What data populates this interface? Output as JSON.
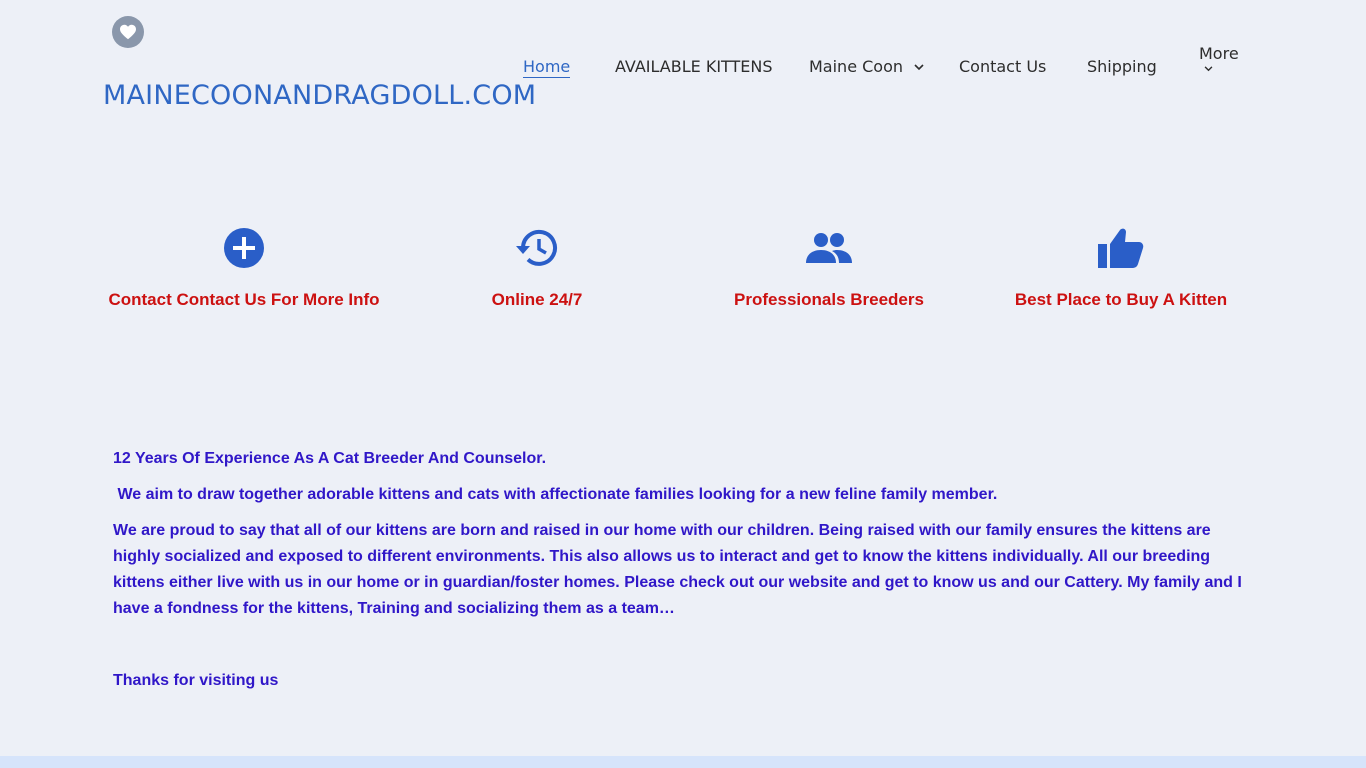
{
  "header": {
    "logo_icon": "heart-icon",
    "site_title": "MAINECOONANDRAGDOLL.COM"
  },
  "nav": {
    "items": [
      {
        "label": "Home",
        "active": true
      },
      {
        "label": "AVAILABLE KITTENS"
      },
      {
        "label": "Maine Coon",
        "dropdown": true
      },
      {
        "label": "Contact Us"
      },
      {
        "label": "Shipping"
      },
      {
        "label": "More",
        "dropdown": true
      }
    ]
  },
  "features": [
    {
      "icon": "plus-circle-icon",
      "label": "Contact Contact Us  For More Info"
    },
    {
      "icon": "history-icon",
      "label": "Online 24/7"
    },
    {
      "icon": "people-icon",
      "label": "Professionals Breeders"
    },
    {
      "icon": "thumbs-up-icon",
      "label": "Best Place to Buy A Kitten"
    }
  ],
  "about": {
    "heading": "12 Years Of Experience As A Cat  Breeder And Counselor.",
    "aim": " We aim to draw together adorable kittens and cats with affectionate families looking for a new feline family member.",
    "body": "We are proud to say that all of our kittens are born and raised in our home with our children. Being raised with our family ensures the kittens are highly socialized and exposed to different environments. This also allows us to interact and get to know the kittens individually. All our breeding kittens either live with us in our home or in guardian/foster homes. Please check out our website and get to know us and our Cattery. My family and I have a fondness for the kittens, Training and socializing them as a team…",
    "thanks": "Thanks for visiting us"
  },
  "colors": {
    "background": "#edf0f7",
    "accent": "#2f67c4",
    "feature_label": "#cc1111",
    "body_text": "#3017c8",
    "icon": "#2a5ec8"
  }
}
